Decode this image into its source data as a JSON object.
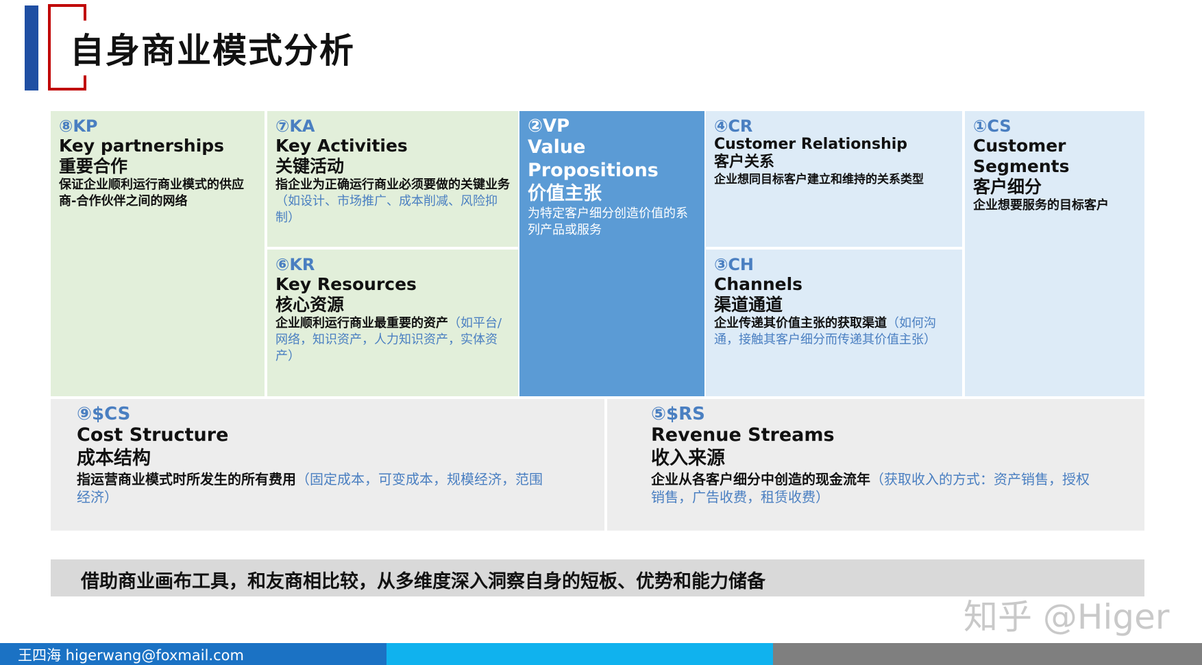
{
  "title": "自身商业模式分析",
  "colors": {
    "accent_blue": "#1f4fa3",
    "accent_red": "#c00000",
    "green_block": "#e2efda",
    "value_prop_block": "#5b9bd5",
    "light_blue_block": "#ddebf7",
    "grey_block": "#ededed",
    "note_text": "#4a7fc1",
    "footer_left": "#1b72c4",
    "footer_mid": "#10b2ee",
    "footer_right": "#7f7f7f"
  },
  "canvas": {
    "kp": {
      "code": "⑧KP",
      "en": "Key partnerships",
      "zh": "重要合作",
      "desc": "保证企业顺利运行商业模式的供应商-合作伙伴之间的网络",
      "note": ""
    },
    "ka": {
      "code": "⑦KA",
      "en": "Key Activities",
      "zh": "关键活动",
      "desc": "指企业为正确运行商业必须要做的关键业务",
      "note": "（如设计、市场推广、成本削减、风险抑制）"
    },
    "kr": {
      "code": "⑥KR",
      "en": "Key Resources",
      "zh": "核心资源",
      "desc": "企业顺利运行商业最重要的资产",
      "note": "（如平台/网络，知识资产，人力知识资产，实体资产）"
    },
    "vp": {
      "code": "②VP",
      "en": "Value Propositions",
      "zh": "价值主张",
      "desc": "为特定客户细分创造价值的系列产品或服务",
      "note": ""
    },
    "cr": {
      "code": "④CR",
      "en": "Customer Relationship",
      "zh": "客户关系",
      "desc": "企业想同目标客户建立和维持的关系类型",
      "note": ""
    },
    "ch": {
      "code": "③CH",
      "en": "Channels",
      "zh": "渠道通道",
      "desc": "企业传递其价值主张的获取渠道",
      "note": "（如何沟通，接触其客户细分而传递其价值主张）"
    },
    "cs": {
      "code": "①CS",
      "en": "Customer Segments",
      "zh": "客户细分",
      "desc": "企业想要服务的目标客户",
      "note": ""
    },
    "cost": {
      "code": "⑨$CS",
      "en": "Cost Structure",
      "zh": "成本结构",
      "desc": "指运营商业模式时所发生的所有费用",
      "note": "（固定成本，可变成本，规模经济，范围经济）"
    },
    "rev": {
      "code": "⑤$RS",
      "en": "Revenue Streams",
      "zh": "收入来源",
      "desc": "企业从各客户细分中创造的现金流年",
      "note": "（获取收入的方式：资产销售，授权销售，广告收费，租赁收费）"
    }
  },
  "summary": "借助商业画布工具，和友商相比较，从多维度深入洞察自身的短板、优势和能力储备",
  "watermark": "知乎 @Higer",
  "footer": "王四海 higerwang@foxmail.com"
}
